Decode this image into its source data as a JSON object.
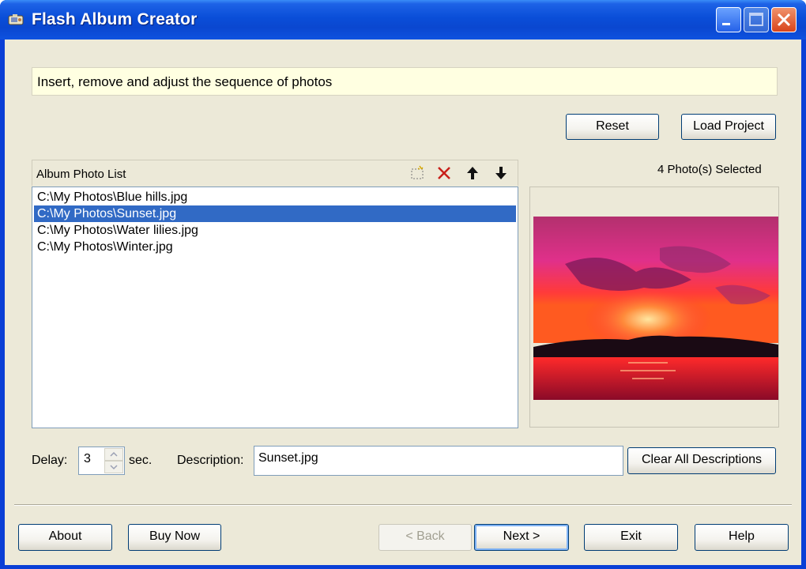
{
  "window": {
    "title": "Flash Album Creator"
  },
  "banner": {
    "text": "Insert, remove and adjust the sequence of photos"
  },
  "top_buttons": {
    "reset": "Reset",
    "load_project": "Load Project"
  },
  "photo_list": {
    "header": "Album Photo List",
    "toolbar_icons": [
      "add-photo-icon",
      "delete-icon",
      "move-up-icon",
      "move-down-icon"
    ],
    "items": [
      "C:\\My Photos\\Blue hills.jpg",
      "C:\\My Photos\\Sunset.jpg",
      "C:\\My Photos\\Water lilies.jpg",
      "C:\\My Photos\\Winter.jpg"
    ],
    "selected_index": 1
  },
  "preview": {
    "selected_count": "4 Photo(s) Selected"
  },
  "options": {
    "delay_label": "Delay:",
    "delay_value": "3",
    "delay_unit": "sec.",
    "description_label": "Description:",
    "description_value": "Sunset.jpg",
    "clear_descriptions": "Clear All Descriptions"
  },
  "footer_buttons": {
    "about": "About",
    "buy_now": "Buy Now",
    "back": "< Back",
    "next": "Next >",
    "exit": "Exit",
    "help": "Help"
  },
  "colors": {
    "titlebar": "#0a4ed8",
    "face": "#ece9d8",
    "selection": "#316ac5",
    "banner": "#ffffe1"
  }
}
